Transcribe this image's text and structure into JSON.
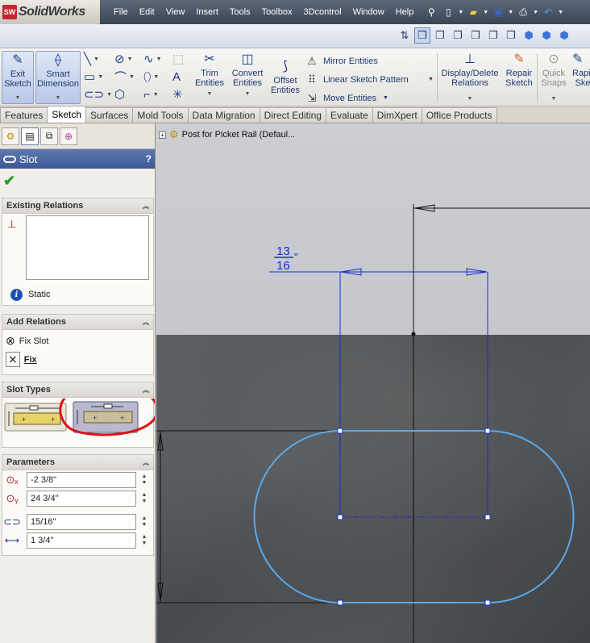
{
  "app": {
    "logo_badge": "SW",
    "name": "SolidWorks"
  },
  "menu": [
    "File",
    "Edit",
    "View",
    "Insert",
    "Tools",
    "Toolbox",
    "3Dcontrol",
    "Window",
    "Help"
  ],
  "title_tools": [
    "pin-icon",
    "new-document-icon",
    "open-folder-icon",
    "save-icon",
    "print-icon",
    "undo-icon"
  ],
  "view_toolbar": [
    "view-orientation-icon",
    "wireframe-icon",
    "hidden-lines-visible-icon",
    "hidden-lines-removed-icon",
    "shaded-edges-icon",
    "shaded-icon",
    "isometric-icon",
    "trimetric-icon",
    "dimetric-icon",
    "view-box-icon"
  ],
  "commands": {
    "exit_sketch": "Exit Sketch",
    "smart_dimension": "Smart Dimension",
    "trim_entities": "Trim Entities",
    "convert_entities": "Convert Entities",
    "offset_entities": "Offset Entities",
    "mirror_entities": "Mirror Entities",
    "linear_sketch_pattern": "Linear Sketch Pattern",
    "move_entities": "Move Entities",
    "display_delete_relations": "Display/Delete Relations",
    "repair_sketch": "Repair Sketch",
    "quick_snaps": "Quick Snaps",
    "rapid_sketch": "Rapid Ske"
  },
  "tabs": [
    "Features",
    "Sketch",
    "Surfaces",
    "Mold Tools",
    "Data Migration",
    "Direct Editing",
    "Evaluate",
    "DimXpert",
    "Office Products"
  ],
  "active_tab": "Sketch",
  "property_manager": {
    "title": "Slot",
    "help": "?",
    "existing_relations": {
      "header": "Existing Relations",
      "status": "Static"
    },
    "add_relations": {
      "header": "Add Relations",
      "fix_slot": "Fix Slot",
      "fix": "Fix"
    },
    "slot_types": {
      "header": "Slot Types"
    },
    "parameters": {
      "header": "Parameters",
      "center_x": "-2 3/8\"",
      "center_y": "24 3/4\"",
      "slot_width": "15/16\"",
      "slot_length": "1 3/4\""
    }
  },
  "feature_tree": {
    "root": "Post for Picket Rail  (Defaul..."
  },
  "dimension": {
    "numerator": "13",
    "denominator": "16",
    "unit": "\""
  },
  "colors": {
    "sketch_blue": "#1a2fd0",
    "slot_outline": "#5aa8e8",
    "highlight_circle": "#e0101a",
    "panel_header": "#4a64a3"
  }
}
